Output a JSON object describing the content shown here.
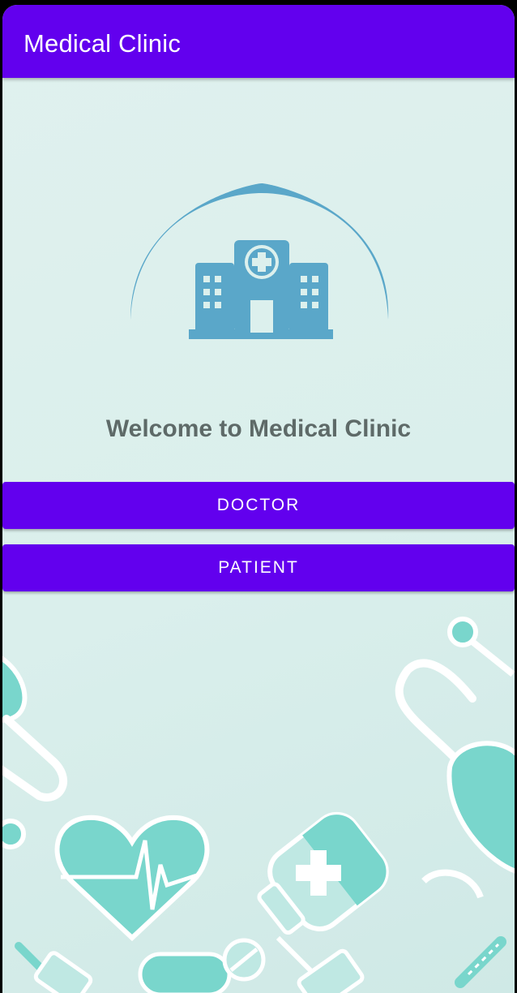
{
  "app": {
    "title": "Medical Clinic"
  },
  "welcome": {
    "text": "Welcome to Medical Clinic"
  },
  "buttons": {
    "doctor": "DOCTOR",
    "patient": "PATIENT"
  },
  "colors": {
    "primary": "#6200ee",
    "logo": "#5aa7c9",
    "accent": "#79d6cc",
    "background": "#dcf0ed",
    "welcome_text": "#5e6a68"
  },
  "icons": {
    "logo": "hospital-logo-icon",
    "background": [
      "stethoscope-icon",
      "heart-pulse-icon",
      "medicine-bottle-icon",
      "pill-icon",
      "syringe-icon",
      "thermometer-icon"
    ]
  }
}
